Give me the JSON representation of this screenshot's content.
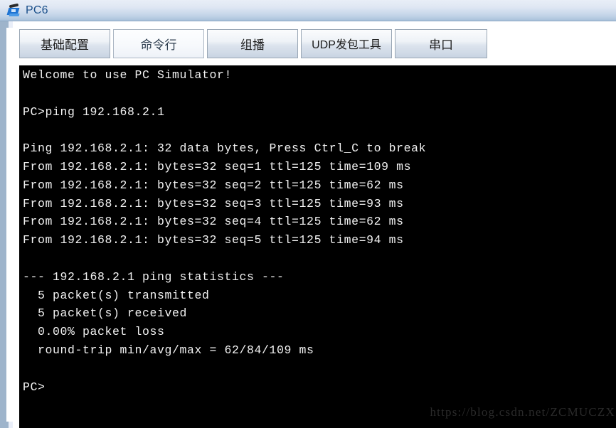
{
  "window": {
    "title": "PC6",
    "icon": "pc-device-icon"
  },
  "tabs": [
    {
      "label": "基础配置",
      "name": "tab-basic-config",
      "active": false
    },
    {
      "label": "命令行",
      "name": "tab-command-line",
      "active": true
    },
    {
      "label": "组播",
      "name": "tab-multicast",
      "active": false
    },
    {
      "label": "UDP发包工具",
      "name": "tab-udp-tool",
      "active": false
    },
    {
      "label": "串口",
      "name": "tab-serial-port",
      "active": false
    }
  ],
  "terminal": {
    "background_color": "#000000",
    "text_color": "#f2f2f2",
    "prompt": "PC>",
    "command": "ping 192.168.2.1",
    "target_ip": "192.168.2.1",
    "lines": [
      "Welcome to use PC Simulator!",
      "",
      "PC>ping 192.168.2.1",
      "",
      "Ping 192.168.2.1: 32 data bytes, Press Ctrl_C to break",
      "From 192.168.2.1: bytes=32 seq=1 ttl=125 time=109 ms",
      "From 192.168.2.1: bytes=32 seq=2 ttl=125 time=62 ms",
      "From 192.168.2.1: bytes=32 seq=3 ttl=125 time=93 ms",
      "From 192.168.2.1: bytes=32 seq=4 ttl=125 time=62 ms",
      "From 192.168.2.1: bytes=32 seq=5 ttl=125 time=94 ms",
      "",
      "--- 192.168.2.1 ping statistics ---",
      "  5 packet(s) transmitted",
      "  5 packet(s) received",
      "  0.00% packet loss",
      "  round-trip min/avg/max = 62/84/109 ms",
      "",
      "PC>"
    ],
    "ping_results": {
      "data_bytes": 32,
      "break_hint": "Press Ctrl_C to break",
      "replies": [
        {
          "bytes": 32,
          "seq": 1,
          "ttl": 125,
          "time_ms": 109
        },
        {
          "bytes": 32,
          "seq": 2,
          "ttl": 125,
          "time_ms": 62
        },
        {
          "bytes": 32,
          "seq": 3,
          "ttl": 125,
          "time_ms": 93
        },
        {
          "bytes": 32,
          "seq": 4,
          "ttl": 125,
          "time_ms": 62
        },
        {
          "bytes": 32,
          "seq": 5,
          "ttl": 125,
          "time_ms": 94
        }
      ],
      "statistics": {
        "transmitted": "5 packet(s) transmitted",
        "received": "5 packet(s) received",
        "loss": "0.00% packet loss",
        "round_trip": "round-trip min/avg/max = 62/84/109 ms",
        "min_ms": 62,
        "avg_ms": 84,
        "max_ms": 109
      }
    }
  },
  "watermark": {
    "text": "https://blog.csdn.net/ZCMUCZX"
  }
}
